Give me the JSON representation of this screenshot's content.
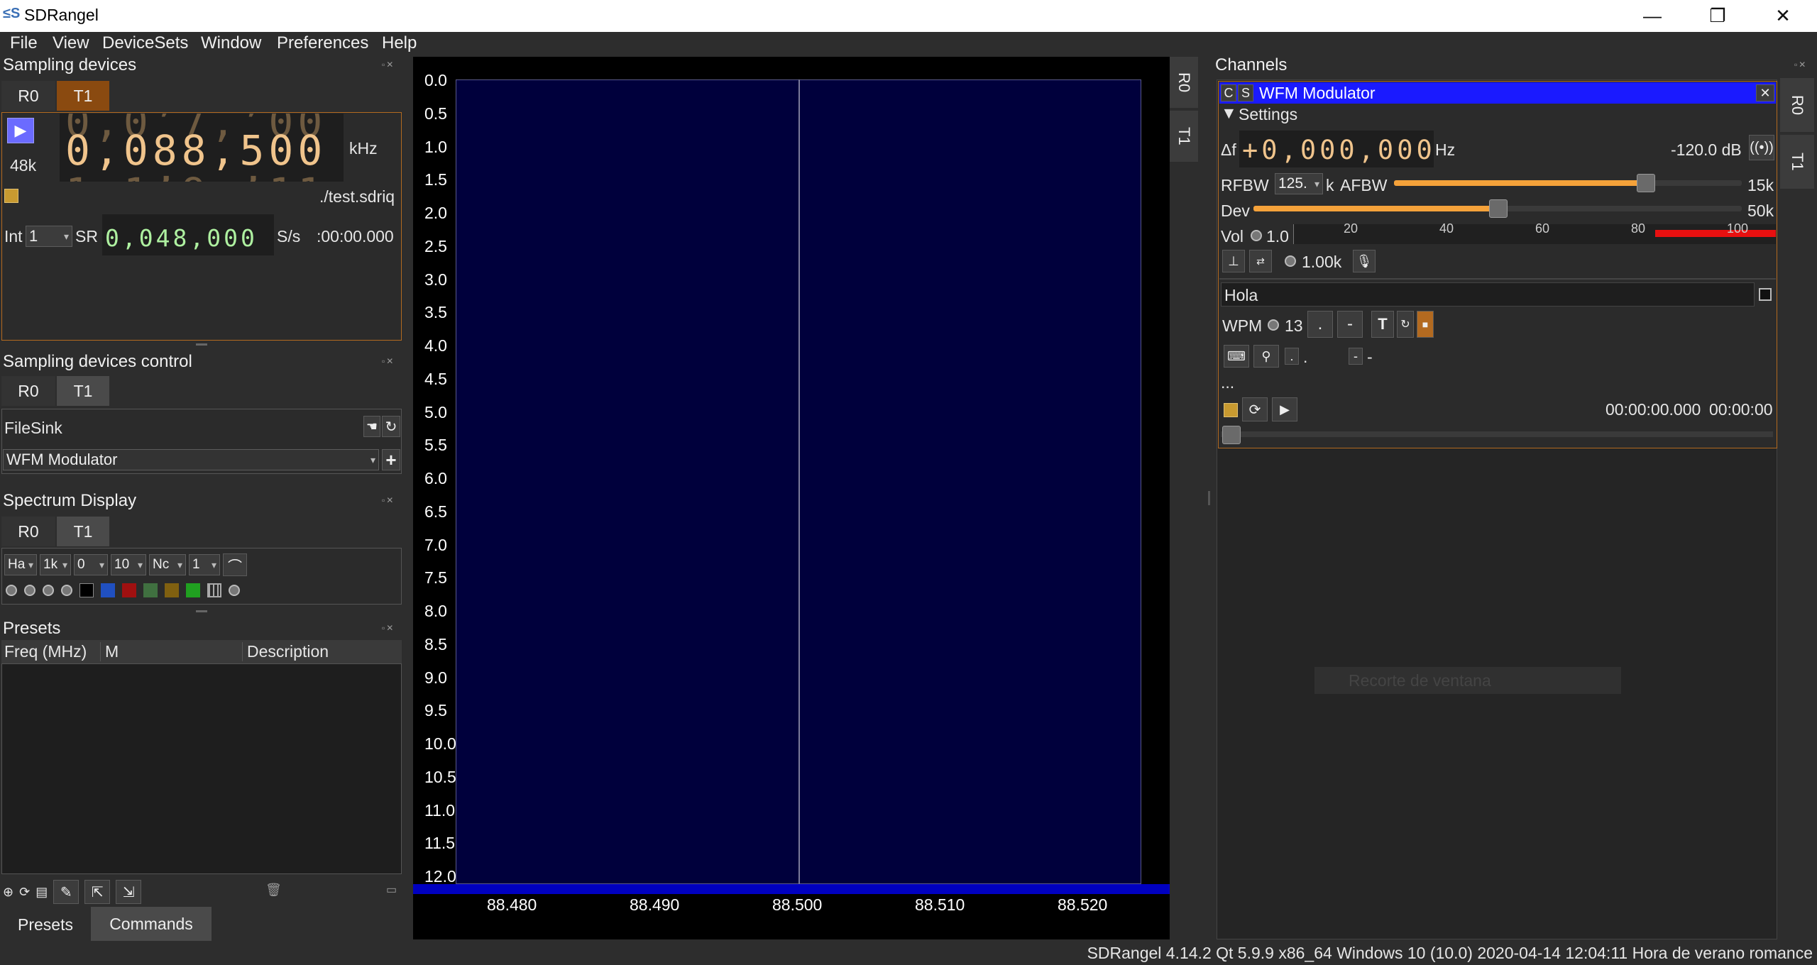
{
  "window": {
    "title": "SDRangel",
    "minimize": "—",
    "restore": "❐",
    "close": "✕"
  },
  "menu": [
    {
      "label": "File",
      "u": "F"
    },
    {
      "label": "View",
      "u": "V"
    },
    {
      "label": "DeviceSets",
      "u": "D"
    },
    {
      "label": "Window",
      "u": "W"
    },
    {
      "label": "Preferences",
      "u": "P"
    },
    {
      "label": "Help",
      "u": "H"
    }
  ],
  "sampling_devices": {
    "title": "Sampling devices",
    "tabs": [
      "R0",
      "T1"
    ],
    "active_tab": "T1",
    "rate": "48k",
    "frequency": "0,088,500",
    "freq_above": "0,0ʼ7,ʼ00",
    "freq_below": "1,1ʼ9,ʼ11",
    "unit": "kHz",
    "file": "./test.sdriq",
    "int_label": "Int",
    "int_value": "1",
    "sr_label": "SR",
    "sr_value": "0,048,000",
    "sr_unit": "S/s",
    "time": ":00:00.000"
  },
  "sampling_control": {
    "title": "Sampling devices control",
    "tabs": [
      "R0",
      "T1"
    ],
    "device": "FileSink",
    "channel": "WFM Modulator"
  },
  "spectrum_display": {
    "title": "Spectrum Display",
    "tabs": [
      "R0",
      "T1"
    ],
    "combos": [
      "Ha",
      "1k",
      "0",
      "10",
      "Nc",
      "1"
    ]
  },
  "presets": {
    "title": "Presets",
    "columns": [
      "Freq (MHz)",
      "M",
      "Description"
    ],
    "bottom_tabs": [
      "Presets",
      "Commands"
    ]
  },
  "spectrum": {
    "background": "#00003c",
    "y_labels": [
      "0.0",
      "0.5",
      "1.0",
      "1.5",
      "2.0",
      "2.5",
      "3.0",
      "3.5",
      "4.0",
      "4.5",
      "5.0",
      "5.5",
      "6.0",
      "6.5",
      "7.0",
      "7.5",
      "8.0",
      "8.5",
      "9.0",
      "9.5",
      "10.0",
      "10.5",
      "11.0",
      "11.5",
      "12.0"
    ],
    "x_labels": [
      "88.480",
      "88.490",
      "88.500",
      "88.510",
      "88.520"
    ],
    "side_tabs": [
      "R0",
      "T1"
    ]
  },
  "channels": {
    "title": "Channels",
    "header": {
      "c": "C",
      "s": "S",
      "name": "WFM Modulator"
    },
    "settings_label": "Settings",
    "df_label": "Δf",
    "df_value": "+0,000,000",
    "df_unit": "Hz",
    "power": "-120.0 dB",
    "rfbw_label": "RFBW",
    "rfbw_value": "125.",
    "rfbw_unit": "k",
    "afbw_label": "AFBW",
    "afbw_value": "15k",
    "afbw_level": 0.73,
    "dev_label": "Dev",
    "dev_value": "50k",
    "dev_level": 0.5,
    "vol_label": "Vol",
    "vol_value": "1.0",
    "meter_ticks": [
      "20",
      "40",
      "60",
      "80",
      "100"
    ],
    "tone_value": "1.00k",
    "cw_text": "Hola",
    "wpm_label": "WPM",
    "wpm_value": "13",
    "dot_btn": ".",
    "dash_btn": "-",
    "t_btn": "T",
    "kb_dot": ".",
    "kb_dash": "-",
    "ellipsis": "...",
    "time1": "00:00:00.000",
    "time2": "00:00:00",
    "side_tabs": [
      "R0",
      "T1"
    ],
    "ghost_text": "Recorte de ventana"
  },
  "status": "SDRangel 4.14.2 Qt 5.9.9 x86_64 Windows 10 (10.0) 2020-04-14 12:04:11 Hora de verano romance",
  "colors": {
    "accent_orange": "#f5a23a",
    "tab_t1_active": "#8a4a10",
    "channel_header": "#1a1aff",
    "meter_red": "#e81010"
  }
}
